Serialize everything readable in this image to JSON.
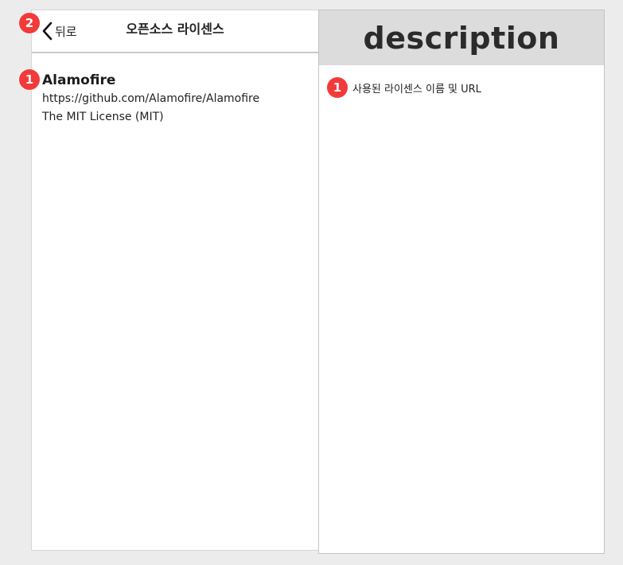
{
  "screen": {
    "back_label": "뒤로",
    "title": "오픈소스 라이센스",
    "license": {
      "name": "Alamofire",
      "url": "https://github.com/Alamofire/Alamofire",
      "type": "The MIT License (MIT)"
    }
  },
  "description": {
    "title": "description",
    "items": [
      {
        "number": "1",
        "text": "사용된 라이센스 이름 및 URL"
      }
    ]
  },
  "markers": {
    "back": "2",
    "license": "1"
  },
  "icons": {
    "back": "chevron-left-icon"
  },
  "colors": {
    "marker": "#f23a3a",
    "description_header_bg": "#dcdcdc",
    "page_bg": "#ececec"
  }
}
